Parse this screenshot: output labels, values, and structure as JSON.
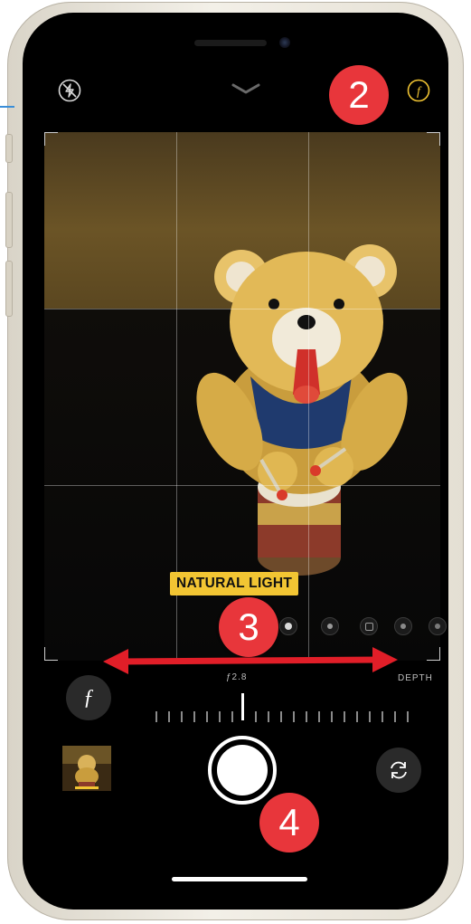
{
  "camera": {
    "lighting_label": "NATURAL LIGHT",
    "aperture_label": "ƒ2.8",
    "depth_label": "DEPTH",
    "aperture_level": 0.5
  },
  "callouts": [
    "2",
    "3",
    "4"
  ],
  "colors": {
    "callout_red": "#e8363b",
    "lighting_yellow": "#f2c533",
    "arrow_red": "#e11e28"
  },
  "icons": {
    "flash_off": "flash-off-icon",
    "chevron": "chevron-down-icon",
    "aperture": "aperture-icon",
    "depth": "f-depth-icon",
    "flip": "camera-flip-icon"
  }
}
